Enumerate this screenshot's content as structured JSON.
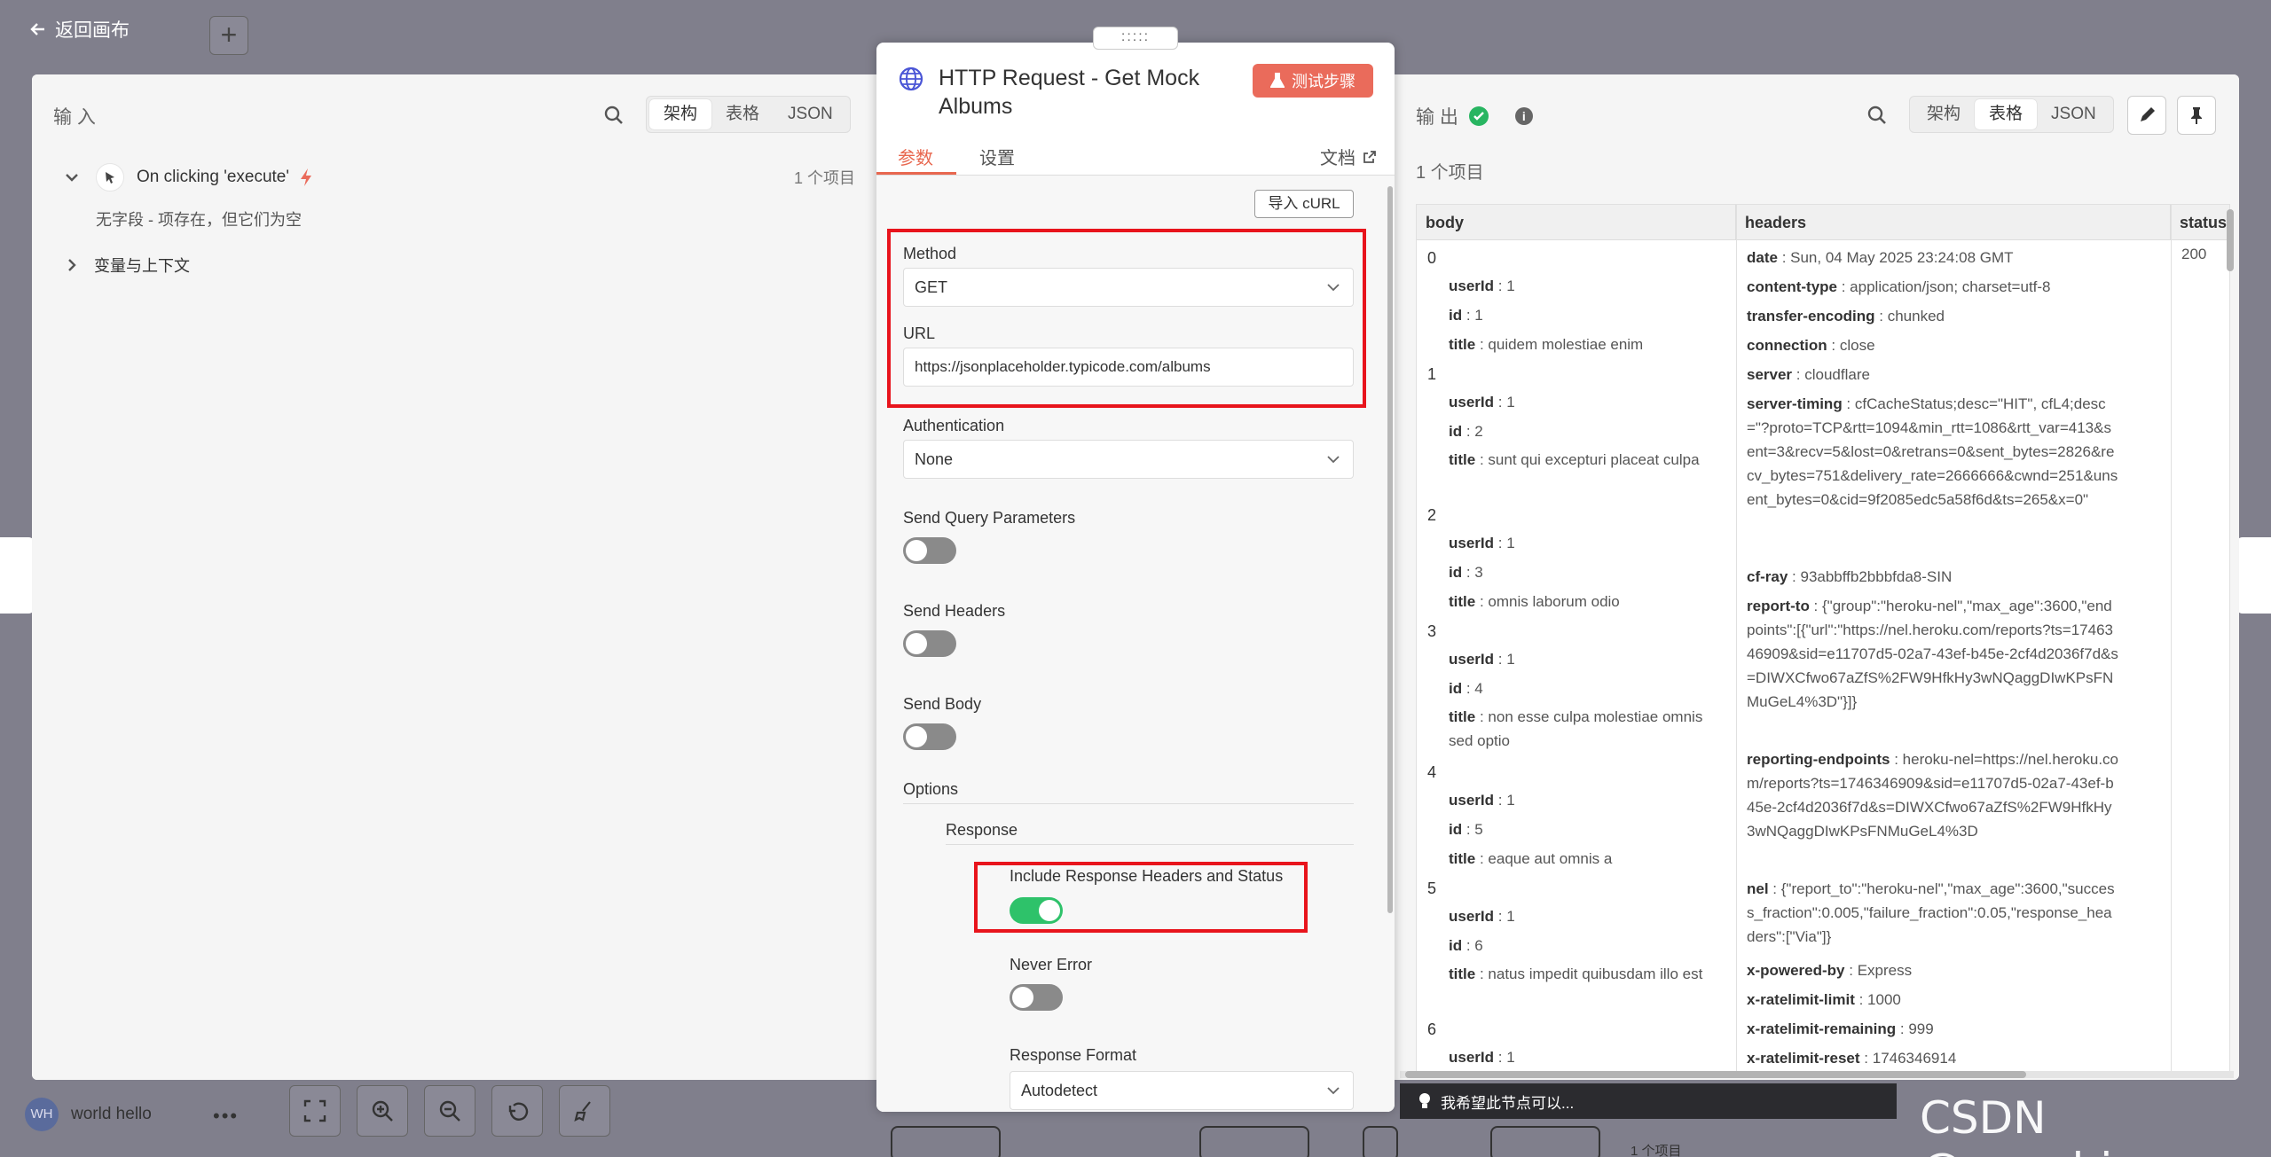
{
  "background": {
    "back_label": "返回画布",
    "add_label": "+",
    "user_name": "world hello",
    "user_initials": "WH",
    "menu_dots": "•••",
    "tip_text": "我希望此节点可以...",
    "bottom_count": "1 个项目",
    "watermark": "CSDN @engchina"
  },
  "input_panel": {
    "title": "输 入",
    "view_options": [
      "架构",
      "表格",
      "JSON"
    ],
    "active_view": "架构",
    "trigger_name": "On clicking 'execute'",
    "trigger_count": "1 个项目",
    "empty_note": "无字段 - 项存在，但它们为空",
    "vars_label": "变量与上下文"
  },
  "dialog": {
    "drag_handle": ":::::",
    "title": "HTTP Request - Get Mock Albums",
    "test_button": "测试步骤",
    "tabs": [
      "参数",
      "设置"
    ],
    "active_tab": "参数",
    "docs_label": "文档",
    "import_curl": "导入 cURL",
    "method_label": "Method",
    "method_value": "GET",
    "url_label": "URL",
    "url_value": "https://jsonplaceholder.typicode.com/albums",
    "auth_label": "Authentication",
    "auth_value": "None",
    "send_query_label": "Send Query Parameters",
    "send_headers_label": "Send Headers",
    "send_body_label": "Send Body",
    "options_label": "Options",
    "response_label": "Response",
    "include_headers_label": "Include Response Headers and Status",
    "never_error_label": "Never Error",
    "response_format_label": "Response Format",
    "response_format_value": "Autodetect",
    "toggles": {
      "send_query": false,
      "send_headers": false,
      "send_body": false,
      "include_headers": true,
      "never_error": false
    }
  },
  "output_panel": {
    "title": "输 出",
    "view_options": [
      "架构",
      "表格",
      "JSON"
    ],
    "active_view": "表格",
    "count": "1 个项目",
    "columns": [
      "body",
      "headers",
      "status"
    ],
    "status_value": "200",
    "body": [
      {
        "index": "0",
        "userId": "1",
        "id": "1",
        "title": "quidem molestiae enim"
      },
      {
        "index": "1",
        "userId": "1",
        "id": "2",
        "title": "sunt qui excepturi placeat culpa"
      },
      {
        "index": "2",
        "userId": "1",
        "id": "3",
        "title": "omnis laborum odio"
      },
      {
        "index": "3",
        "userId": "1",
        "id": "4",
        "title": "non esse culpa molestiae omnis sed optio"
      },
      {
        "index": "4",
        "userId": "1",
        "id": "5",
        "title": "eaque aut omnis a"
      },
      {
        "index": "5",
        "userId": "1",
        "id": "6",
        "title": "natus impedit quibusdam illo est"
      },
      {
        "index": "6",
        "userId": "1"
      }
    ],
    "headers": [
      {
        "key": "date",
        "value": "Sun, 04 May 2025 23:24:08 GMT"
      },
      {
        "key": "content-type",
        "value": "application/json; charset=utf-8"
      },
      {
        "key": "transfer-encoding",
        "value": "chunked"
      },
      {
        "key": "connection",
        "value": "close"
      },
      {
        "key": "server",
        "value": "cloudflare"
      },
      {
        "key": "server-timing",
        "value": "cfCacheStatus;desc=\"HIT\", cfL4;desc=\"?proto=TCP&rtt=1094&min_rtt=1086&rtt_var=413&sent=3&recv=5&lost=0&retrans=0&sent_bytes=2826&recv_bytes=751&delivery_rate=2666666&cwnd=251&unsent_bytes=0&cid=9f2085edc5a58f6d&ts=265&x=0\""
      },
      {
        "key": "cf-ray",
        "value": "93abbffb2bbbfda8-SIN"
      },
      {
        "key": "report-to",
        "value": "{\"group\":\"heroku-nel\",\"max_age\":3600,\"endpoints\":[{\"url\":\"https://nel.heroku.com/reports?ts=1746346909&sid=e11707d5-02a7-43ef-b45e-2cf4d2036f7d&s=DIWXCfwo67aZfS%2FW9HfkHy3wNQaggDIwKPsFNMuGeL4%3D\"}]}"
      },
      {
        "key": "reporting-endpoints",
        "value": "heroku-nel=https://nel.heroku.com/reports?ts=1746346909&sid=e11707d5-02a7-43ef-b45e-2cf4d2036f7d&s=DIWXCfwo67aZfS%2FW9HfkHy3wNQaggDIwKPsFNMuGeL4%3D"
      },
      {
        "key": "nel",
        "value": "{\"report_to\":\"heroku-nel\",\"max_age\":3600,\"success_fraction\":0.005,\"failure_fraction\":0.05,\"response_headers\":[\"Via\"]}"
      },
      {
        "key": "x-powered-by",
        "value": "Express"
      },
      {
        "key": "x-ratelimit-limit",
        "value": "1000"
      },
      {
        "key": "x-ratelimit-remaining",
        "value": "999"
      },
      {
        "key": "x-ratelimit-reset",
        "value": "1746346914"
      }
    ]
  },
  "colors": {
    "accent": "#e8674f",
    "toggle_on": "#2ec26a",
    "highlight": "#e8141c",
    "success": "#28b561"
  }
}
